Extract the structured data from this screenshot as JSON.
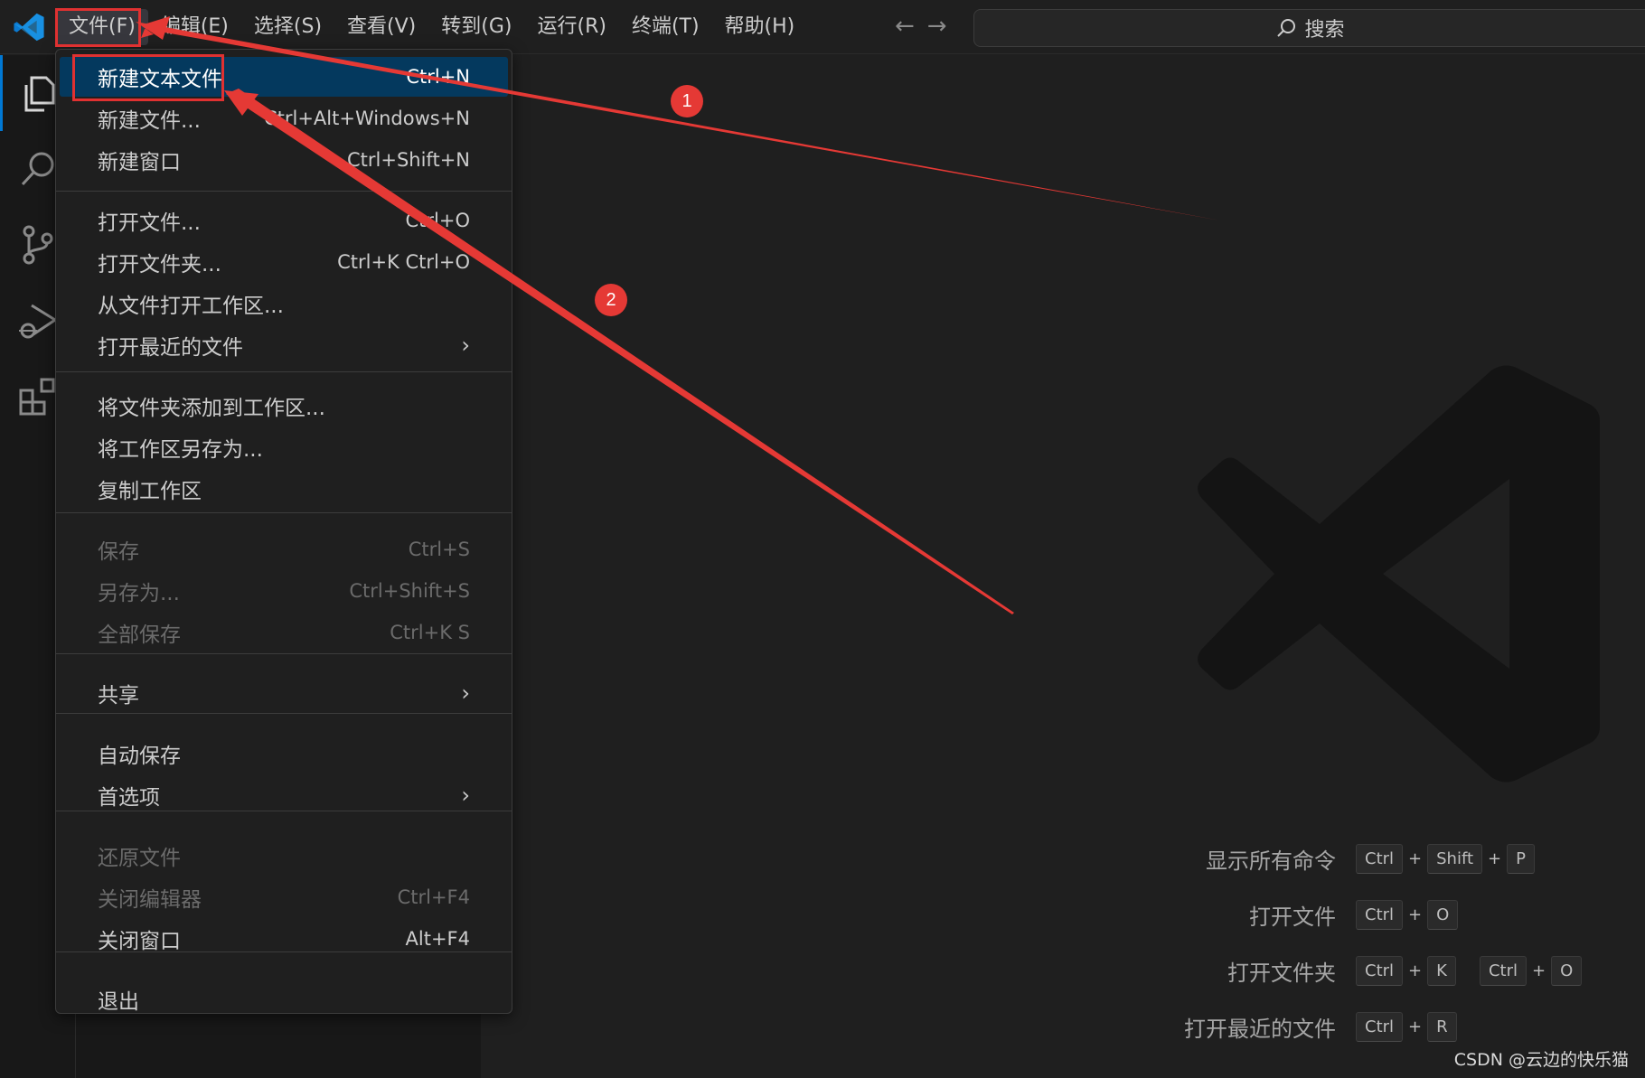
{
  "menubar": {
    "items": [
      {
        "label": "文件(F)"
      },
      {
        "label": "编辑(E)"
      },
      {
        "label": "选择(S)"
      },
      {
        "label": "查看(V)"
      },
      {
        "label": "转到(G)"
      },
      {
        "label": "运行(R)"
      },
      {
        "label": "终端(T)"
      },
      {
        "label": "帮助(H)"
      }
    ],
    "back_arrow": "←",
    "forward_arrow": "→"
  },
  "search": {
    "label": "搜索",
    "icon": "search-icon"
  },
  "activity": {
    "items": [
      "files-icon",
      "search-icon",
      "source-control-icon",
      "run-debug-icon",
      "extensions-icon"
    ],
    "accent": "#0078d4"
  },
  "file_menu": {
    "items": [
      {
        "label": "新建文本文件",
        "accel": "Ctrl+N",
        "selected": true
      },
      {
        "label": "新建文件...",
        "accel": "Ctrl+Alt+Windows+N"
      },
      {
        "label": "新建窗口",
        "accel": "Ctrl+Shift+N"
      },
      {
        "label": "打开文件...",
        "accel": "Ctrl+O"
      },
      {
        "label": "打开文件夹...",
        "accel": "Ctrl+K Ctrl+O"
      },
      {
        "label": "从文件打开工作区...",
        "accel": ""
      },
      {
        "label": "打开最近的文件",
        "accel": "",
        "submenu": true
      },
      {
        "label": "将文件夹添加到工作区...",
        "accel": ""
      },
      {
        "label": "将工作区另存为...",
        "accel": ""
      },
      {
        "label": "复制工作区",
        "accel": ""
      },
      {
        "label": "保存",
        "accel": "Ctrl+S",
        "disabled": true
      },
      {
        "label": "另存为...",
        "accel": "Ctrl+Shift+S",
        "disabled": true
      },
      {
        "label": "全部保存",
        "accel": "Ctrl+K S",
        "disabled": true
      },
      {
        "label": "共享",
        "accel": "",
        "submenu": true
      },
      {
        "label": "自动保存",
        "accel": ""
      },
      {
        "label": "首选项",
        "accel": "",
        "submenu": true
      },
      {
        "label": "还原文件",
        "accel": "",
        "disabled": true
      },
      {
        "label": "关闭编辑器",
        "accel": "Ctrl+F4",
        "disabled": true
      },
      {
        "label": "关闭窗口",
        "accel": "Alt+F4"
      },
      {
        "label": "退出",
        "accel": ""
      }
    ],
    "chevron": "›",
    "selected_bg": "#04395e"
  },
  "shortcuts": [
    {
      "label": "显示所有命令",
      "keys": [
        [
          "Ctrl",
          "Shift",
          "P"
        ]
      ]
    },
    {
      "label": "打开文件",
      "keys": [
        [
          "Ctrl",
          "O"
        ]
      ]
    },
    {
      "label": "打开文件夹",
      "keys": [
        [
          "Ctrl",
          "K"
        ],
        [
          "Ctrl",
          "O"
        ]
      ]
    },
    {
      "label": "打开最近的文件",
      "keys": [
        [
          "Ctrl",
          "R"
        ]
      ]
    }
  ],
  "annotations": {
    "badges": [
      "1",
      "2"
    ],
    "color": "#e53935"
  },
  "credit": "CSDN @云边的快乐猫"
}
